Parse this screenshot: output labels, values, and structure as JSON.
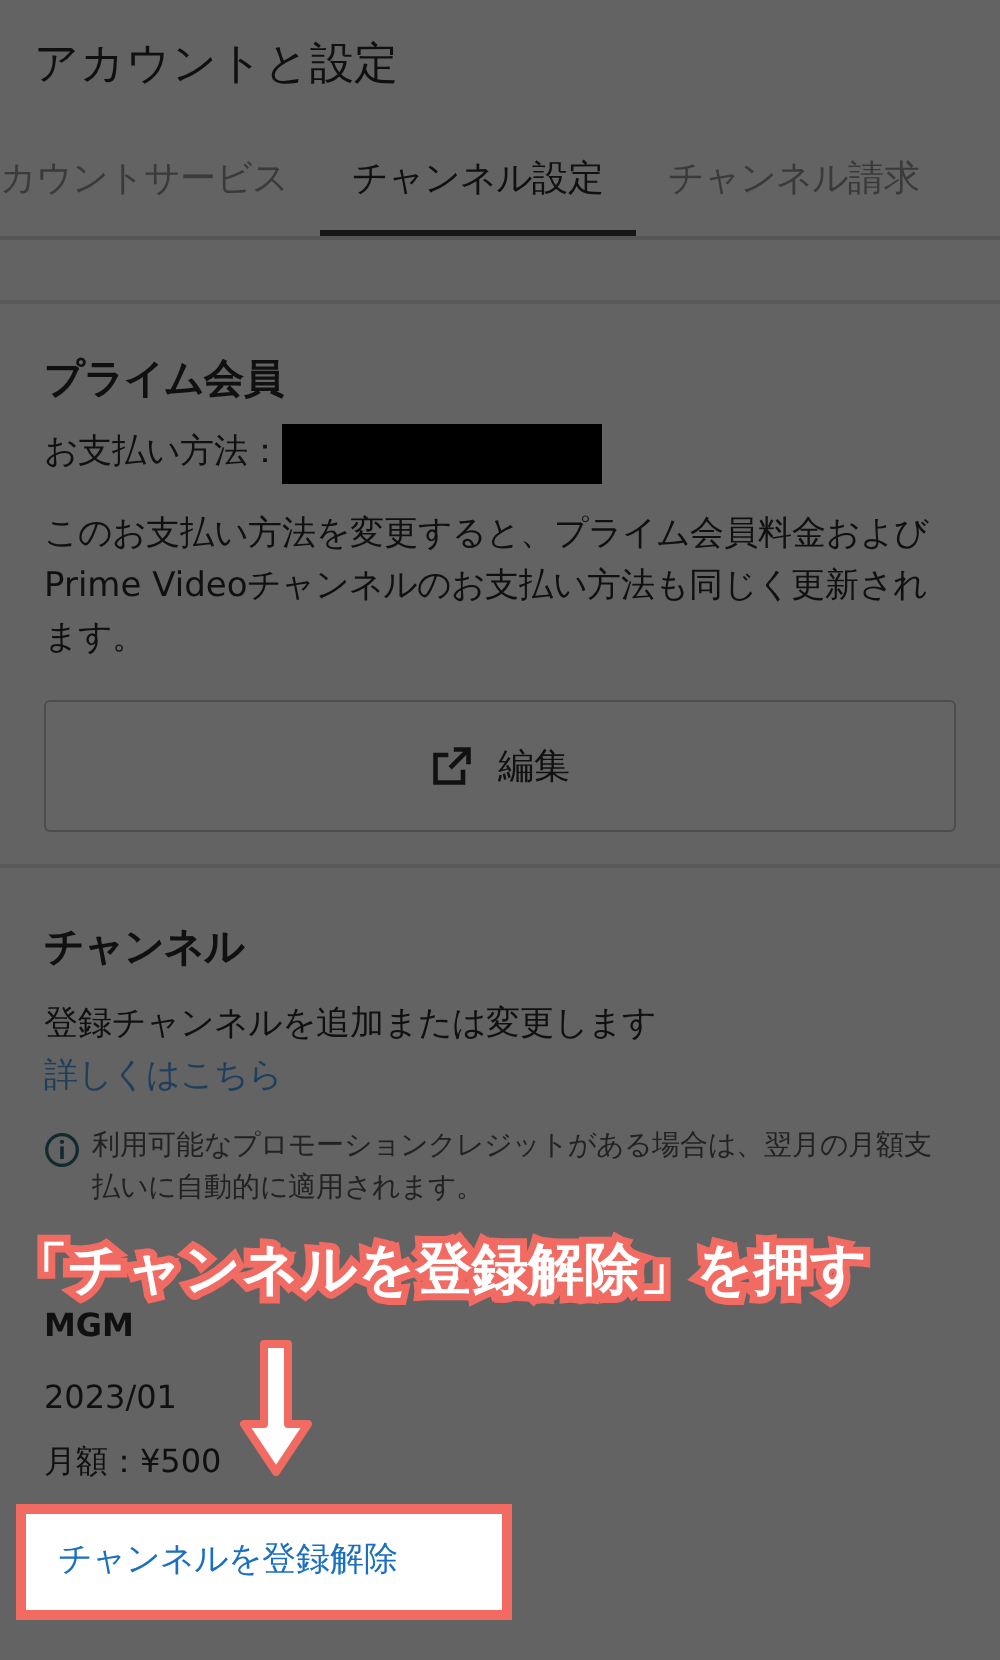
{
  "header": {
    "title": "アカウントと設定"
  },
  "tabs": [
    {
      "label": "カウントサービス",
      "selected": false
    },
    {
      "label": "チャンネル設定",
      "selected": true
    },
    {
      "label": "チャンネル請求",
      "selected": false
    }
  ],
  "prime": {
    "heading": "プライム会員",
    "payment_label": "お支払い方法：",
    "payment_redacted": true,
    "note": "このお支払い方法を変更すると、プライム会員料金およびPrime Videoチャンネルのお支払い方法も同じく更新されます。",
    "edit_button": "編集"
  },
  "channels": {
    "heading": "チャンネル",
    "description": "登録チャンネルを追加または変更します",
    "link": "詳しくはこちら",
    "info": "利用可能なプロモーションクレジットがある場合は、翌月の月額支払いに自動的に適用されます。",
    "channel": {
      "name": "MGM",
      "date": "2023/01",
      "price": "月額：¥500"
    },
    "unsubscribe": "チャンネルを登録解除"
  },
  "annotation": {
    "callout": "「チャンネルを登録解除」を押す",
    "arrow": true
  }
}
